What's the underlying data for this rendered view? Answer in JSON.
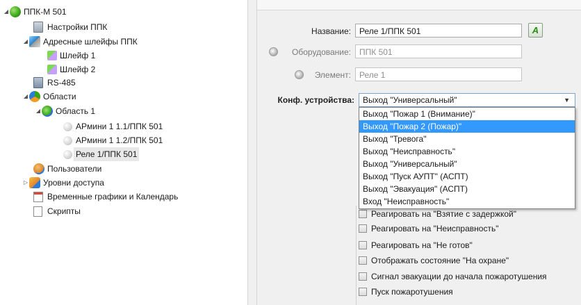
{
  "tree": {
    "root": "ППК-М 501",
    "settings": "Настройки ППК",
    "address_loops": "Адресные шлейфы ППК",
    "loop1": "Шлейф 1",
    "loop2": "Шлейф 2",
    "rs485": "RS-485",
    "areas": "Области",
    "area1": "Область 1",
    "device1": "АРмини 1 1.1/ППК 501",
    "device2": "АРмини 1 1.2/ППК 501",
    "device3": "Реле 1/ППК 501",
    "users": "Пользователи",
    "access": "Уровни доступа",
    "schedules": "Временные графики и Календарь",
    "scripts": "Скрипты"
  },
  "props": {
    "name_label": "Название:",
    "name_value": "Реле 1/ППК 501",
    "equipment_label": "Оборудование:",
    "equipment_value": "ППК 501",
    "element_label": "Элемент:",
    "element_value": "Реле 1",
    "config_label": "Конф. устройства:",
    "config_value": "Выход \"Универсальный\"",
    "button_a": "A"
  },
  "dropdown": {
    "options": [
      "Выход \"Пожар 1 (Внимание)\"",
      "Выход \"Пожар 2 (Пожар)\"",
      "Выход \"Тревога\"",
      "Выход \"Неисправность\"",
      "Выход \"Универсальный\"",
      "Выход \"Пуск АУПТ\" (АСПТ)",
      "Выход \"Эвакуация\" (АСПТ)",
      "Вход \"Неисправность\""
    ],
    "highlighted_index": 1
  },
  "checkboxes": [
    "Реагировать на \"Взятие с задержкой\"",
    "Реагировать на \"Неисправность\"",
    "Реагировать на \"Не готов\"",
    "Отображать состояние \"На охране\"",
    "Сигнал эвакуации до начала пожаротушения",
    "Пуск пожаротушения"
  ],
  "colors": {
    "highlight": "#3399ff",
    "panel": "#f0f0f0"
  }
}
